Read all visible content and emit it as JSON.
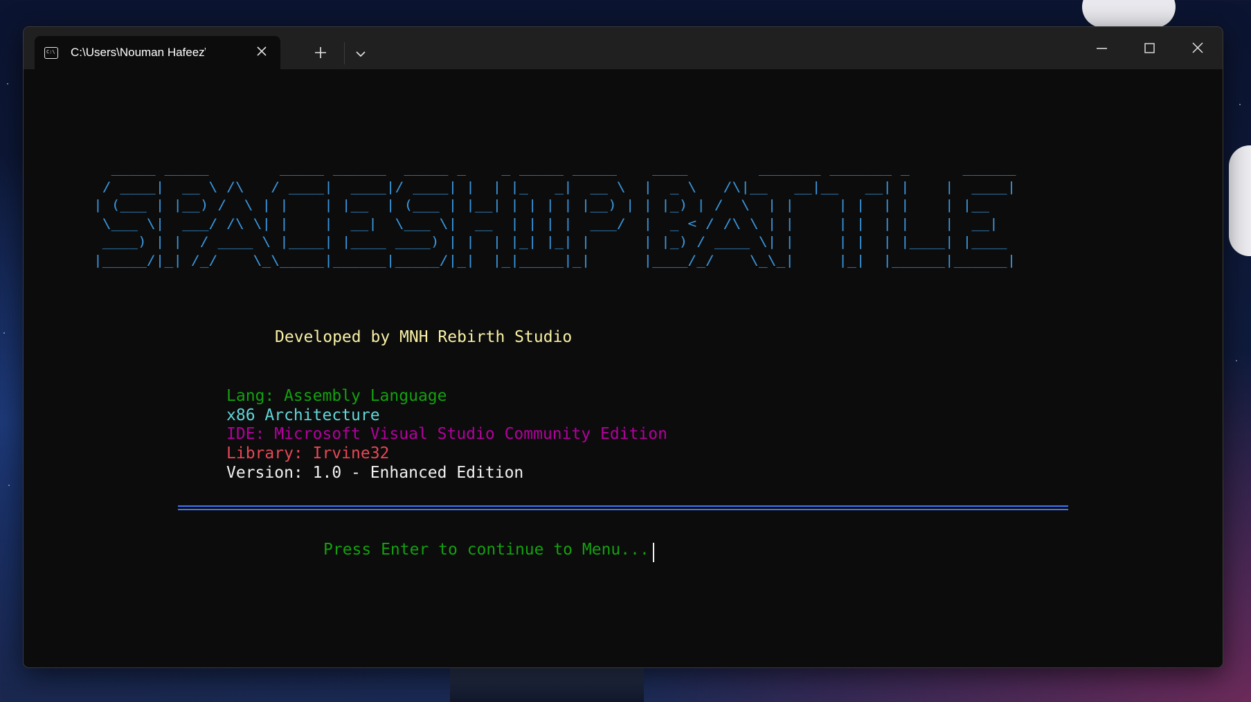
{
  "window": {
    "tab_title": "C:\\Users\\Nouman Hafeez\\Des",
    "tab_icon_text": "C:\\"
  },
  "terminal": {
    "ascii_art": "  _____ _____        _____ ______  _____ _    _ _____ _____    ____        _______ _______ _      ______ \n / ____|  __ \\ /\\   / ____|  ____|/ ____| |  | |_   _|  __ \\  |  _ \\   /\\|__   __|__   __| |    |  ____|\n| (___ | |__) /  \\ | |    | |__  | (___ | |__| | | | | |__) | | |_) | /  \\  | |     | |  | |    | |__   \n \\___ \\|  ___/ /\\ \\| |    |  __|  \\___ \\|  __  | | | |  ___/  |  _ < / /\\ \\ | |     | |  | |    |  __|  \n ____) | |  / ____ \\ |____| |____ ____) | |  | |_| |_| |      | |_) / ____ \\| |     | |  | |____| |____ \n|_____/|_| /_/    \\_\\_____|______|_____/|_|  |_|_____|_|      |____/_/    \\_\\_|     |_|  |______|______|",
    "developer": "Developed by MNH Rebirth Studio",
    "lang": "Lang: Assembly Language",
    "arch": "x86 Architecture",
    "ide": "IDE: Microsoft Visual Studio Community Edition",
    "library": "Library: Irvine32",
    "version": "Version: 1.0 - Enhanced Edition",
    "divider": "==========================================================================================",
    "prompt": "Press Enter to continue to Menu..."
  },
  "colors": {
    "ascii": "#3a96dd",
    "developer": "#f9f1a5",
    "lang": "#13a10e",
    "arch": "#61d6d6",
    "ide": "#b4009e",
    "library": "#e74856",
    "version": "#f2f2f2",
    "divider": "#3b78ff",
    "prompt": "#13a10e"
  }
}
